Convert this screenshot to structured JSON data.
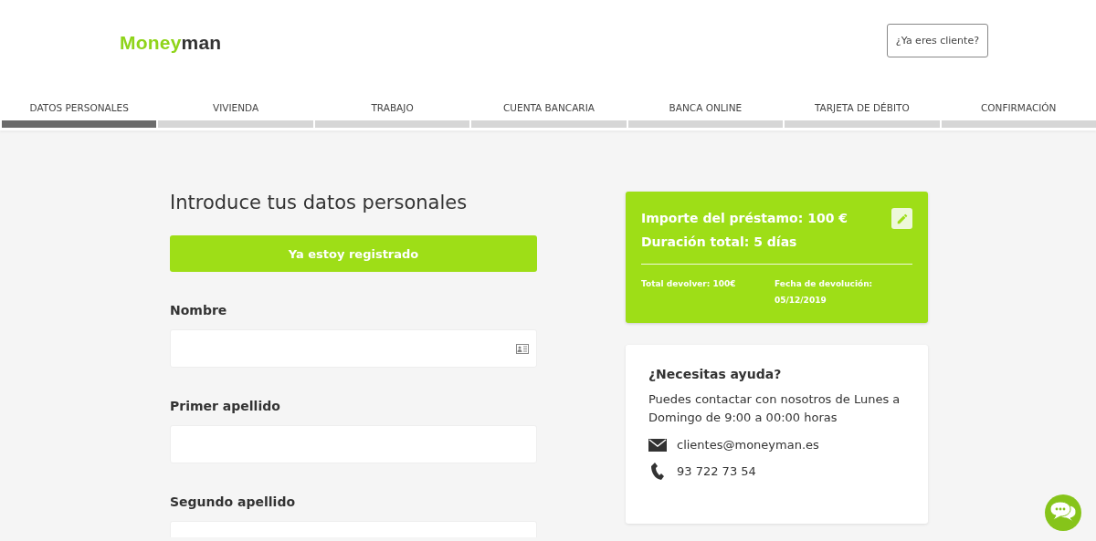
{
  "logo": {
    "part_1": "Money",
    "part_2": "man"
  },
  "header_button": "¿Ya eres cliente?",
  "steps": [
    {
      "label": "DATOS PERSONALES",
      "selected": true
    },
    {
      "label": "VIVIENDA",
      "selected": false
    },
    {
      "label": "TRABAJO",
      "selected": false
    },
    {
      "label": "CUENTA BANCARIA",
      "selected": false
    },
    {
      "label": "BANCA ONLINE",
      "selected": false
    },
    {
      "label": "TARJETA DE DÉBITO",
      "selected": false
    },
    {
      "label": "CONFIRMACIÓN",
      "selected": false
    }
  ],
  "form": {
    "title": "Introduce tus datos personales",
    "registered_button": "Ya estoy registrado",
    "fields": [
      {
        "label": "Nombre",
        "has_icon": true
      },
      {
        "label": "Primer apellido",
        "has_icon": false
      },
      {
        "label": "Segundo apellido",
        "has_icon": false
      }
    ]
  },
  "loan_card": {
    "amount": "Importe del préstamo: 100 €",
    "duration": "Duración total: 5 días",
    "total": "Total devolver: 100€",
    "date_label": "Fecha de devolución:",
    "date": "05/12/2019"
  },
  "help_card": {
    "title": "¿Necesitas ayuda?",
    "text": "Puedes contactar con nosotros de Lunes a Domingo de 9:00 a 00:00 horas",
    "email": "clientes@moneyman.es",
    "phone": "93 722 73 54"
  }
}
